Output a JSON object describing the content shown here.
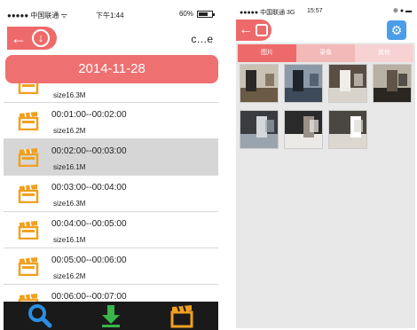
{
  "left": {
    "status": {
      "carrier": "●●●●● 中国联通 ᯤ",
      "time": "下午1:44",
      "battery": "60%"
    },
    "header": {
      "back_icon": "back-arrow-icon",
      "download_icon": "download-circle-icon",
      "title": "c…e"
    },
    "date": "2014-11-28",
    "list": [
      {
        "range": "",
        "size": "size16.3M",
        "partial": true
      },
      {
        "range": "00:01:00--00:02:00",
        "size": "size16.2M"
      },
      {
        "range": "00:02:00--00:03:00",
        "size": "size16.1M",
        "selected": true
      },
      {
        "range": "00:03:00--00:04:00",
        "size": "size16.3M"
      },
      {
        "range": "00:04:00--00:05:00",
        "size": "size16.1M"
      },
      {
        "range": "00:05:00--00:06:00",
        "size": "size16.2M"
      },
      {
        "range": "00:06:00--00:07:00",
        "size": "size16.3M"
      }
    ],
    "toolbar": [
      "search-icon",
      "download-icon",
      "clapperboard-icon"
    ],
    "colors": {
      "accent": "#ee6a6a",
      "toolbar_bg": "#1a1a1a",
      "search": "#2a8fe0",
      "download": "#39b54a",
      "clap": "#f0a020"
    }
  },
  "right": {
    "status": {
      "carrier": "●●●●● 中国联通 3G",
      "time": "15:57",
      "icons": "⊕ ● ▬"
    },
    "header": {
      "back_icon": "back-arrow-icon",
      "camera_icon": "camera-icon",
      "settings_icon": "gear-icon"
    },
    "tabs": [
      {
        "label": "图片",
        "active": true
      },
      {
        "label": "录像"
      },
      {
        "label": "其他"
      }
    ],
    "thumbnails": [
      {
        "name": "room-photo-1"
      },
      {
        "name": "room-photo-2"
      },
      {
        "name": "room-photo-3"
      },
      {
        "name": "room-photo-4"
      },
      {
        "name": "room-photo-5"
      },
      {
        "name": "room-photo-6"
      },
      {
        "name": "room-photo-7"
      }
    ]
  }
}
